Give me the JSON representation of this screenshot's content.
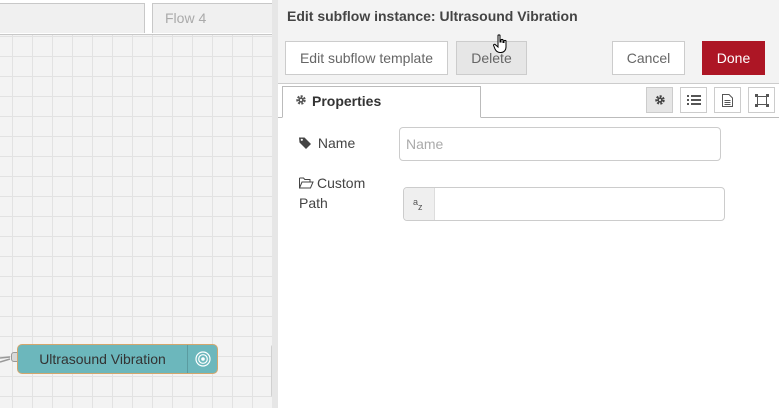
{
  "workspace": {
    "tabs": [
      {
        "label": ""
      },
      {
        "label": "Flow 4"
      }
    ],
    "node": {
      "label": "Ultrasound Vibration",
      "color": "#6cb7bc",
      "border_color": "#d2a66d",
      "button_icon": "broadcast-icon"
    }
  },
  "tray": {
    "title": "Edit subflow instance: Ultrasound Vibration",
    "buttons": {
      "edit_template": "Edit subflow template",
      "delete": "Delete",
      "cancel": "Cancel",
      "done": "Done"
    },
    "done_color": "#ad1625",
    "tabs": {
      "properties": "Properties",
      "icon_buttons": [
        "gear-icon",
        "list-icon",
        "document-icon",
        "layout-icon"
      ],
      "selected": "gear-icon"
    },
    "form": {
      "name_label": "Name",
      "name_placeholder": "Name",
      "name_value": "",
      "path_label": "Custom Path",
      "path_type_glyph": "az",
      "path_value": ""
    }
  }
}
